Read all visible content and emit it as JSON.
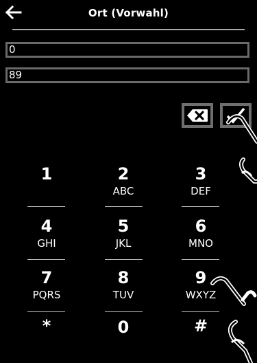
{
  "header": {
    "title": "Ort (Vorwahl)",
    "back_icon": "arrow-left-icon"
  },
  "fields": [
    {
      "value": "0"
    },
    {
      "value": "89"
    }
  ],
  "toolbar": {
    "delete_icon": "backspace-x-icon",
    "confirm_icon": "checkmark-icon"
  },
  "keypad": {
    "keys": [
      {
        "digit": "1",
        "letters": ""
      },
      {
        "digit": "2",
        "letters": "ABC"
      },
      {
        "digit": "3",
        "letters": "DEF"
      },
      {
        "digit": "4",
        "letters": "GHI"
      },
      {
        "digit": "5",
        "letters": "JKL"
      },
      {
        "digit": "6",
        "letters": "MNO"
      },
      {
        "digit": "7",
        "letters": "PQRS"
      },
      {
        "digit": "8",
        "letters": "TUV"
      },
      {
        "digit": "9",
        "letters": "WXYZ"
      },
      {
        "digit": "*",
        "letters": ""
      },
      {
        "digit": "0",
        "letters": ""
      },
      {
        "digit": "#",
        "letters": ""
      }
    ]
  },
  "colors": {
    "background": "#000000",
    "text": "#ffffff",
    "field_border": "#6a6a6a",
    "separator": "#bdbdbd"
  }
}
